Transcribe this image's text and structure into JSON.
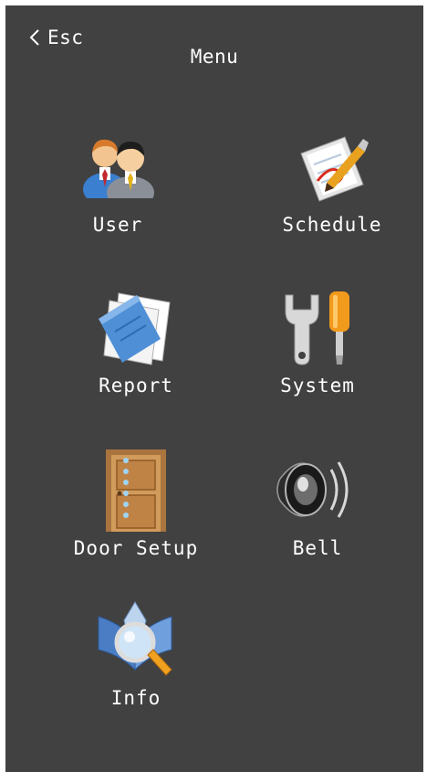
{
  "header": {
    "back_label": "Esc",
    "title": "Menu"
  },
  "menu": {
    "items": [
      {
        "label": "User",
        "icon": "users-icon"
      },
      {
        "label": "Schedule",
        "icon": "schedule-icon"
      },
      {
        "label": "Report",
        "icon": "report-icon"
      },
      {
        "label": "System",
        "icon": "system-tools-icon"
      },
      {
        "label": "Door Setup",
        "icon": "door-icon"
      },
      {
        "label": "Bell",
        "icon": "speaker-bell-icon"
      },
      {
        "label": "Info",
        "icon": "info-magnifier-icon"
      }
    ]
  },
  "colors": {
    "background": "#414141",
    "text": "#ffffff"
  }
}
